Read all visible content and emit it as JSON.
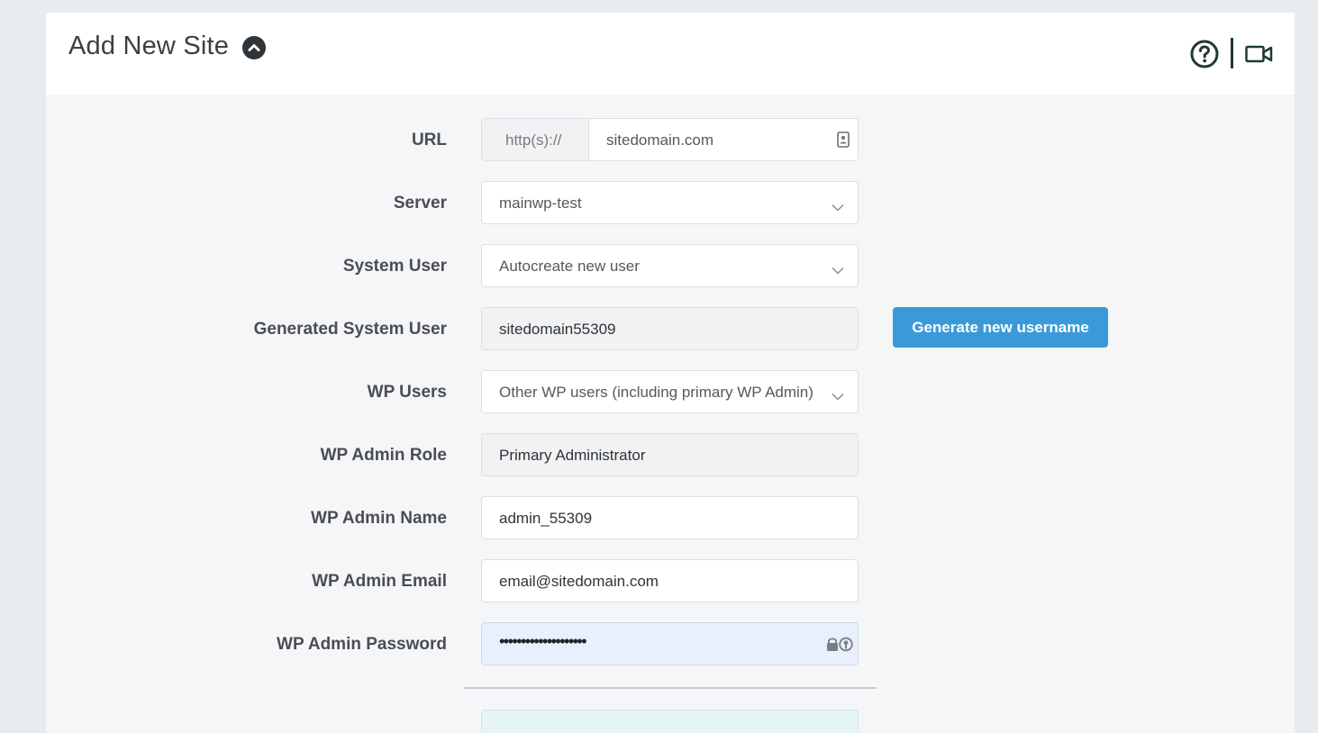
{
  "header": {
    "title": "Add New Site",
    "icons": [
      "chevron-up-circle-icon",
      "help-circle-icon",
      "video-icon"
    ]
  },
  "form": {
    "url": {
      "label": "URL",
      "prefix": "http(s)://",
      "value": "sitedomain.com"
    },
    "server": {
      "label": "Server",
      "value": "mainwp-test"
    },
    "system_user": {
      "label": "System User",
      "value": "Autocreate new user"
    },
    "generated_system_user": {
      "label": "Generated System User",
      "value": "sitedomain55309",
      "button_label": "Generate new username"
    },
    "wp_users": {
      "label": "WP Users",
      "value": "Other WP users (including primary WP Admin)"
    },
    "wp_admin_role": {
      "label": "WP Admin Role",
      "value": "Primary Administrator"
    },
    "wp_admin_name": {
      "label": "WP Admin Name",
      "value": "admin_55309"
    },
    "wp_admin_email": {
      "label": "WP Admin Email",
      "value": "email@sitedomain.com"
    },
    "wp_admin_password": {
      "label": "WP Admin Password",
      "value": "••••••••••••••••••••"
    }
  },
  "colors": {
    "primary_button": "#3a9ad9",
    "panel_bg": "#f5f6f8",
    "page_bg": "#e8ecef",
    "password_bg": "#e8f0fe",
    "notice_bg": "#e5f5f5"
  }
}
